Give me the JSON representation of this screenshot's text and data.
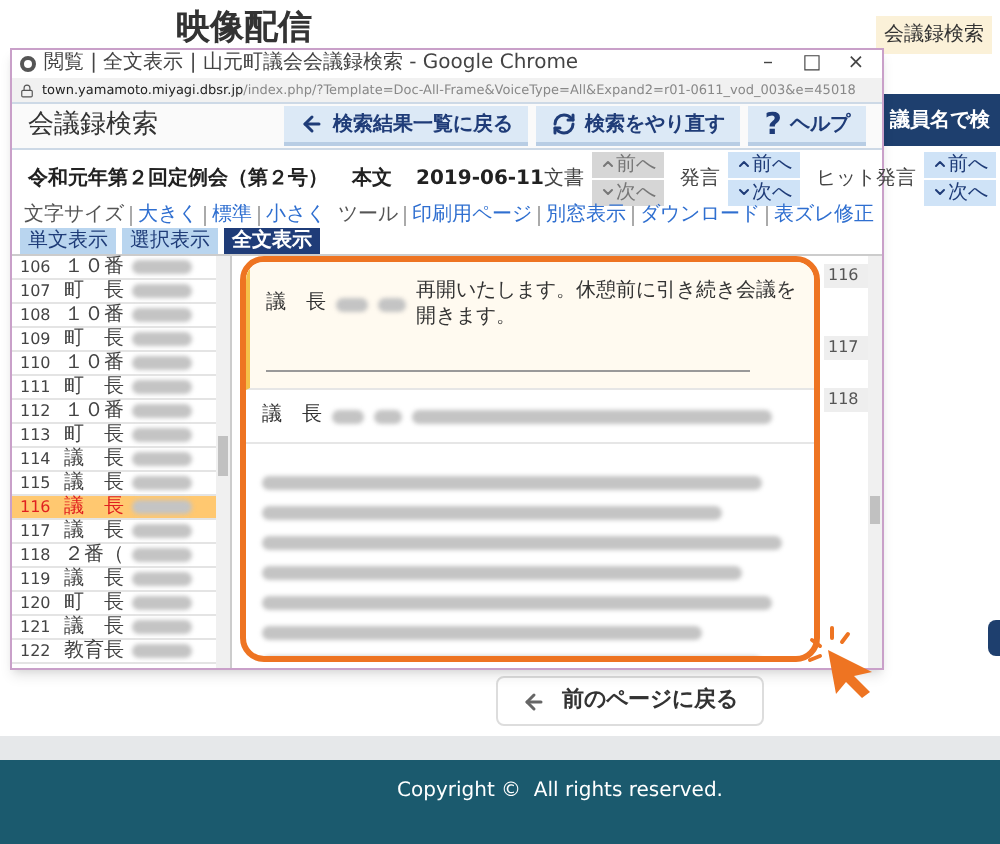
{
  "page": {
    "title": "映像配信",
    "badge": "会議録検索",
    "side_button": "議員名で検",
    "back_button": "前のページに戻る",
    "footer": "Copyright ©  All rights reserved."
  },
  "popup": {
    "window_title": "閲覧 | 全文表示 | 山元町議会会議録検索 - Google Chrome",
    "window_controls": [
      "–",
      "□",
      "×"
    ],
    "url_host": "town.yamamoto.miyagi.dbsr.jp",
    "url_path": "/index.php/?Template=Doc-All-Frame&VoiceType=All&Expand2=r01-0611_vod_003&e=45018",
    "app_title": "会議録検索",
    "header_buttons": [
      {
        "kind": "back",
        "label": "検索結果一覧に戻る"
      },
      {
        "kind": "refresh",
        "label": "検索をやり直す"
      },
      {
        "kind": "help",
        "symbol": "?",
        "label": "ヘルプ"
      }
    ],
    "meeting": {
      "name": "令和元年第２回定例会（第２号）",
      "section": "本文",
      "date": "2019-06-11"
    },
    "nav_groups": [
      {
        "label": "文書",
        "prev": "前へ",
        "next": "次へ",
        "disabled": true
      },
      {
        "label": "発言",
        "prev": "前へ",
        "next": "次へ",
        "disabled": false
      },
      {
        "label": "ヒット発言",
        "prev": "前へ",
        "next": "次へ",
        "disabled": false
      }
    ],
    "view_tabs": [
      {
        "label": "単文表示",
        "selected": false
      },
      {
        "label": "選択表示",
        "selected": false
      },
      {
        "label": "全文表示",
        "selected": true
      }
    ],
    "tools": [
      {
        "kind": "label",
        "text": "文字サイズ"
      },
      {
        "kind": "link",
        "text": "大きく"
      },
      {
        "kind": "link",
        "text": "標準"
      },
      {
        "kind": "link",
        "text": "小さく"
      },
      {
        "kind": "label",
        "text": "ツール"
      },
      {
        "kind": "link",
        "text": "印刷用ページ"
      },
      {
        "kind": "link",
        "text": "別窓表示"
      },
      {
        "kind": "link",
        "text": "ダウンロード"
      },
      {
        "kind": "link",
        "text": "表ズレ修正"
      }
    ],
    "speakers": [
      {
        "number": "106",
        "role": "１０番",
        "selected": false
      },
      {
        "number": "107",
        "role": "町　長",
        "selected": false
      },
      {
        "number": "108",
        "role": "１０番",
        "selected": false
      },
      {
        "number": "109",
        "role": "町　長",
        "selected": false
      },
      {
        "number": "110",
        "role": "１０番",
        "selected": false
      },
      {
        "number": "111",
        "role": "町　長",
        "selected": false
      },
      {
        "number": "112",
        "role": "１０番",
        "selected": false
      },
      {
        "number": "113",
        "role": "町　長",
        "selected": false
      },
      {
        "number": "114",
        "role": "議　長",
        "selected": false
      },
      {
        "number": "115",
        "role": "議　長",
        "selected": false
      },
      {
        "number": "116",
        "role": "議　長",
        "selected": true
      },
      {
        "number": "117",
        "role": "議　長",
        "selected": false
      },
      {
        "number": "118",
        "role": "２番（",
        "selected": false
      },
      {
        "number": "119",
        "role": "議　長",
        "selected": false
      },
      {
        "number": "120",
        "role": "町　長",
        "selected": false
      },
      {
        "number": "121",
        "role": "議　長",
        "selected": false
      },
      {
        "number": "122",
        "role": "教育長",
        "selected": false
      }
    ],
    "speeches": [
      {
        "number": "116",
        "role": "議　長",
        "text": "再開いたします。休憩前に引き続き会議を開きます。",
        "selected": true
      },
      {
        "number": "117",
        "role": "議　長",
        "selected": false
      },
      {
        "number": "118",
        "selected": false
      }
    ]
  }
}
